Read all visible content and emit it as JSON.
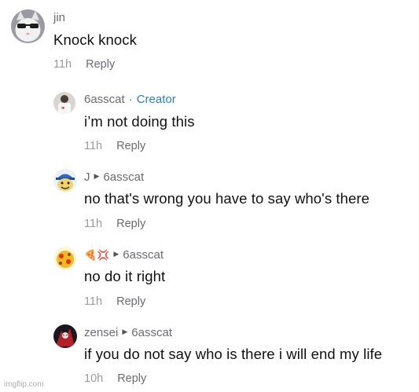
{
  "comments": [
    {
      "author": "jin",
      "text": "Knock knock",
      "time": "11h",
      "reply_label": "Reply",
      "avatar": "cat-with-sunglasses"
    },
    {
      "author": "6asscat",
      "separator": "·",
      "badge": "Creator",
      "text": "i’m not doing this",
      "time": "11h",
      "reply_label": "Reply",
      "avatar": "person-white-shirt"
    },
    {
      "author": "J",
      "reply_to": "6asscat",
      "text": "no that's wrong you have to say who's there",
      "time": "11h",
      "reply_label": "Reply",
      "avatar": "cartoon-character-blue-cap"
    },
    {
      "author": "🍕💢",
      "reply_to": "6asscat",
      "text": "no do it right",
      "time": "11h",
      "reply_label": "Reply",
      "avatar": "cartoon-yellow-red"
    },
    {
      "author": "zensei",
      "reply_to": "6asscat",
      "text": "if you do not say who is there i will end my life",
      "time": "10h",
      "reply_label": "Reply",
      "avatar": "red-dark-character"
    }
  ],
  "watermark": "imgflip.com",
  "colors": {
    "creator_badge": "#2a7fd0",
    "meta_time": "#9a9aa0",
    "reply": "#6b6b72"
  }
}
